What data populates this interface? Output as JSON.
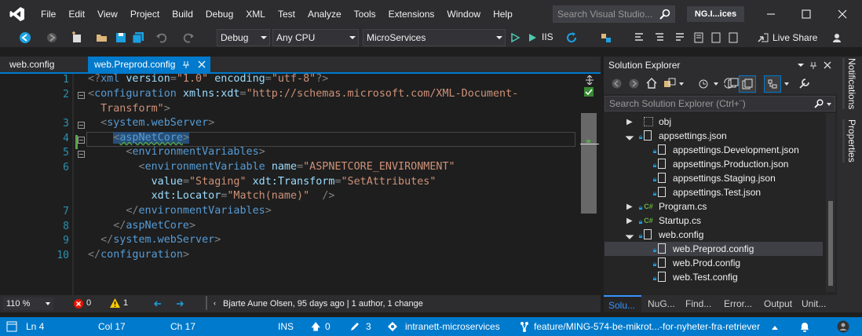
{
  "menu": [
    "File",
    "Edit",
    "View",
    "Project",
    "Build",
    "Debug",
    "XML",
    "Test",
    "Analyze",
    "Tools",
    "Extensions",
    "Window",
    "Help"
  ],
  "search": {
    "placeholder": "Search Visual Studio..."
  },
  "solution_name": "NG.I...ices",
  "toolbar": {
    "config": "Debug",
    "platform": "Any CPU",
    "startup_project": "MicroServices",
    "run_label": "IIS",
    "live_share": "Live Share"
  },
  "tabs": [
    {
      "label": "web.config",
      "active": false
    },
    {
      "label": "web.Preprod.config",
      "active": true
    }
  ],
  "editor": {
    "line_numbers": [
      "1",
      "2",
      "",
      "3",
      "4",
      "5",
      "6",
      "",
      "",
      "7",
      "8",
      "9",
      "10"
    ]
  },
  "editor_status": {
    "zoom": "110 %",
    "errors": "0",
    "warnings": "1",
    "blame": "Bjarte Aune Olsen, 95 days ago | 1 author, 1 change"
  },
  "solution_explorer": {
    "title": "Solution Explorer",
    "search_placeholder": "Search Solution Explorer (Ctrl+¨)",
    "items": [
      {
        "label": "obj"
      },
      {
        "label": "appsettings.json"
      },
      {
        "label": "appsettings.Development.json"
      },
      {
        "label": "appsettings.Production.json"
      },
      {
        "label": "appsettings.Staging.json"
      },
      {
        "label": "appsettings.Test.json"
      },
      {
        "label": "Program.cs"
      },
      {
        "label": "Startup.cs"
      },
      {
        "label": "web.config"
      },
      {
        "label": "web.Preprod.config"
      },
      {
        "label": "web.Prod.config"
      },
      {
        "label": "web.Test.config"
      }
    ],
    "bottom_tabs": [
      "Solu...",
      "NuG...",
      "Find...",
      "Error...",
      "Output",
      "Unit..."
    ]
  },
  "side_strip": [
    "Notifications",
    "Properties"
  ],
  "status": {
    "ln": "Ln 4",
    "col": "Col 17",
    "ch": "Ch 17",
    "mode": "INS",
    "up": "0",
    "edits": "3",
    "repo": "intranett-microservices",
    "branch": "feature/MING-574-be-mikrot...-for-nyheter-fra-retriever"
  },
  "colors": {
    "accent": "#007acc",
    "chrome": "#2d2d30",
    "editor_bg": "#1e1e1e"
  }
}
